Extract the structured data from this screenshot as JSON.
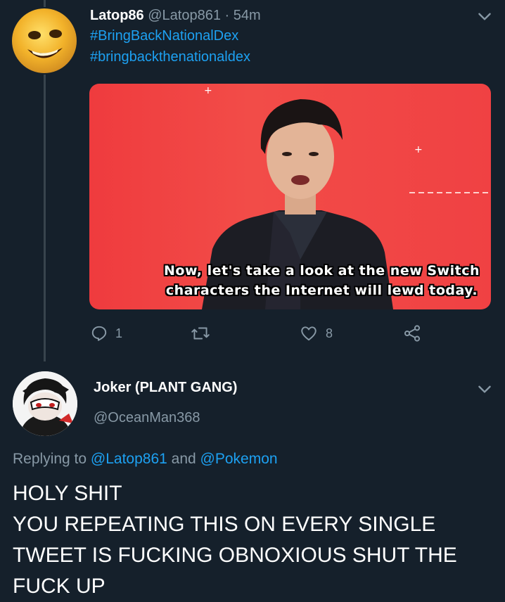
{
  "tweet1": {
    "display_name": "Latop86",
    "handle": "@Latop861",
    "separator": " · ",
    "time": "54m",
    "hashtags": [
      "#BringBackNationalDex",
      "#bringbackthenationaldex"
    ],
    "media_caption_lines": [
      "Now, let's take a look at the new Switch",
      "characters the Internet will lewd today."
    ],
    "replies": "1",
    "retweets": "",
    "likes": "8"
  },
  "tweet2": {
    "display_name": "Joker (PLANT GANG)",
    "handle": "@OceanMan368",
    "replying_prefix": "Replying to ",
    "replying_to_1": "@Latop861",
    "replying_and": " and ",
    "replying_to_2": "@Pokemon",
    "body_lines": [
      "HOLY SHIT",
      "YOU REPEATING THIS ON EVERY SINGLE",
      "TWEET IS FUCKING OBNOXIOUS SHUT THE",
      "FUCK UP"
    ]
  },
  "icons": {
    "more": "chevron-down-icon",
    "reply": "reply-icon",
    "retweet": "retweet-icon",
    "like": "heart-icon",
    "share": "share-icon"
  },
  "colors": {
    "background": "#15202b",
    "accent": "#1da1f2",
    "muted": "#8899a6",
    "media_red": "#ef3b3e"
  }
}
